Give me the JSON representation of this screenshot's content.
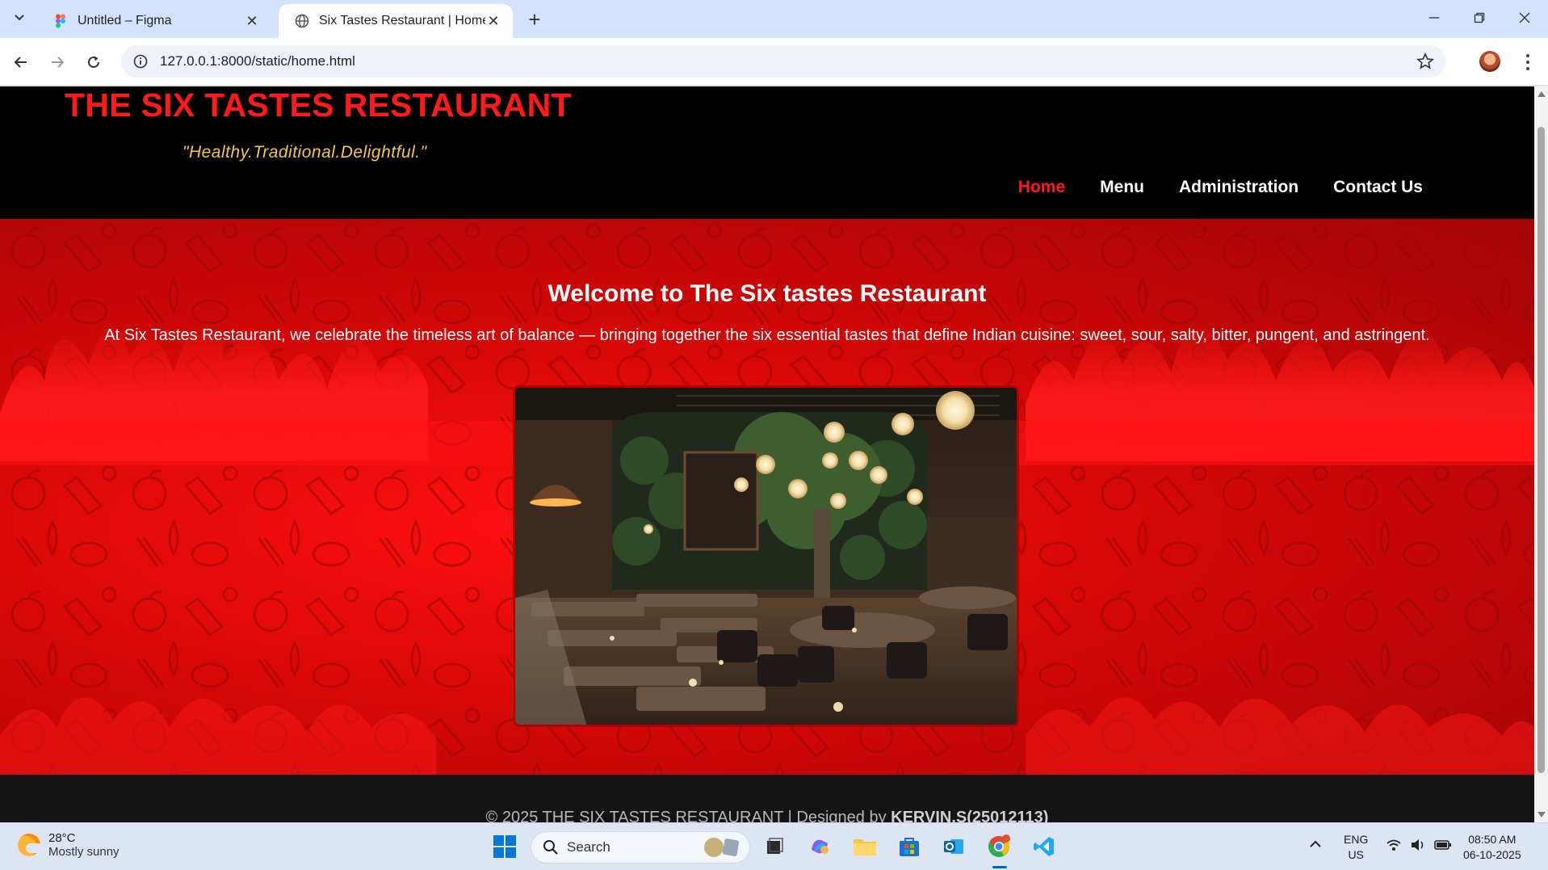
{
  "browser": {
    "tabs": [
      {
        "title": "Untitled – Figma",
        "active": false,
        "icon": "figma-icon"
      },
      {
        "title": "Six Tastes Restaurant | Home",
        "active": true,
        "icon": "globe-icon"
      }
    ],
    "url": "127.0.0.1:8000/static/home.html"
  },
  "site": {
    "brand": "THE SIX TASTES RESTAURANT",
    "tagline": "\"Healthy.Traditional.Delightful.\"",
    "nav": [
      {
        "label": "Home",
        "active": true
      },
      {
        "label": "Menu",
        "active": false
      },
      {
        "label": "Administration",
        "active": false
      },
      {
        "label": "Contact Us",
        "active": false
      }
    ],
    "hero": {
      "title": "Welcome to The Six tastes Restaurant",
      "text": "At Six Tastes Restaurant, we celebrate the timeless art of balance — bringing together the six essential tastes that define Indian cuisine: sweet, sour, salty, bitter, pungent, and astringent.",
      "image_alt": "Restaurant interior"
    },
    "footer": {
      "prefix": "© 2025 THE SIX TASTES RESTAURANT | Designed by ",
      "designer": "KERVIN.S(25012113)"
    },
    "colors": {
      "brand_red": "#ff1a1a",
      "tagline_gold": "#f3c74d",
      "header_bg": "#000000",
      "hero_red": "#e00808"
    }
  },
  "taskbar": {
    "weather_temp": "28°C",
    "weather_desc": "Mostly sunny",
    "search_placeholder": "Search",
    "lang_top": "ENG",
    "lang_bottom": "US",
    "time": "08:50 AM",
    "date": "06-10-2025"
  }
}
